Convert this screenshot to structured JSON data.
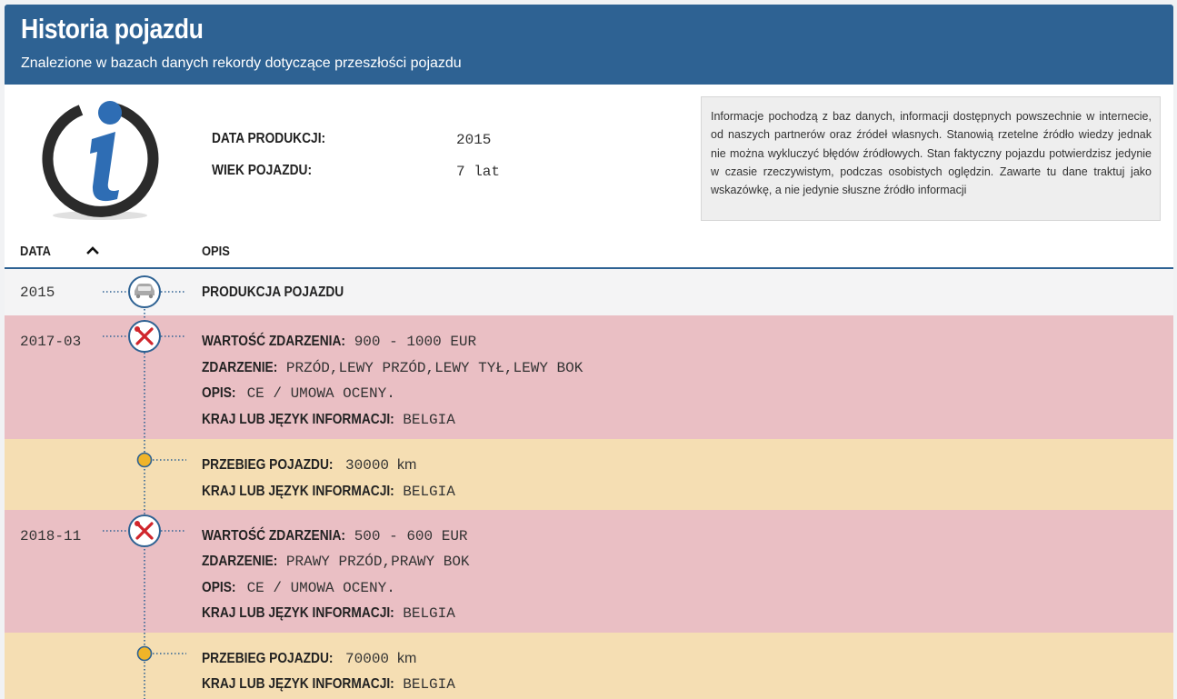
{
  "header": {
    "title": "Historia pojazdu",
    "subtitle": "Znalezione w bazach danych rekordy dotyczące przeszłości pojazdu"
  },
  "specs": {
    "production_label": "DATA PRODUKCJI:",
    "production_value": "2015",
    "age_label": "WIEK POJAZDU:",
    "age_value": "7 lat"
  },
  "info_text": "Informacje pochodzą z baz danych, informacji dostępnych powszechnie w internecie, od naszych partnerów oraz źródeł własnych. Stanowią rzetelne źródło wiedzy jednak nie można wykluczyć błędów źródłowych. Stan faktyczny pojazdu potwierdzisz jedynie w czasie rzeczywistym, podczas osobistych oględzin. Zawarte tu dane traktuj jako wskazówkę, a nie jedynie słuszne źródło informacji",
  "table": {
    "col_date": "DATA",
    "col_desc": "OPIS",
    "sort_icon": "chevron-up-icon"
  },
  "events": [
    {
      "type": "production",
      "date": "2015",
      "icon": "car-icon",
      "title": "PRODUKCJA POJAZDU"
    },
    {
      "type": "damage",
      "date": "2017-03",
      "icon": "wrench-screwdriver-icon",
      "value_label": "WARTOŚĆ ZDARZENIA:",
      "value": "900 - 1000 EUR",
      "event_label": "ZDARZENIE:",
      "event": "PRZÓD,LEWY PRZÓD,LEWY TYŁ,LEWY BOK",
      "desc_label": "OPIS:",
      "desc": "CE / UMOWA OCENY.",
      "country_label": "KRAJ LUB JĘZYK INFORMACJI:",
      "country": "BELGIA"
    },
    {
      "type": "mileage",
      "date": "",
      "icon": "dot-marker-icon",
      "mileage_label": "PRZEBIEG POJAZDU:",
      "mileage": "30000",
      "unit": "km",
      "country_label": "KRAJ LUB JĘZYK INFORMACJI:",
      "country": "BELGIA"
    },
    {
      "type": "damage",
      "date": "2018-11",
      "icon": "wrench-screwdriver-icon",
      "value_label": "WARTOŚĆ ZDARZENIA:",
      "value": "500 - 600 EUR",
      "event_label": "ZDARZENIE:",
      "event": "PRAWY PRZÓD,PRAWY BOK",
      "desc_label": "OPIS:",
      "desc": "CE / UMOWA OCENY.",
      "country_label": "KRAJ LUB JĘZYK INFORMACJI:",
      "country": "BELGIA"
    },
    {
      "type": "mileage",
      "date": "",
      "icon": "dot-marker-icon",
      "mileage_label": "PRZEBIEG POJAZDU:",
      "mileage": "70000",
      "unit": "km",
      "country_label": "KRAJ LUB JĘZYK INFORMACJI:",
      "country": "BELGIA"
    }
  ],
  "colors": {
    "header": "#2e6293",
    "damage_row": "#eabfc4",
    "mileage_row": "#f5deb3",
    "production_row": "#f4f4f5",
    "timeline_dot": "#f0b429",
    "damage_icon": "#d0262c"
  }
}
